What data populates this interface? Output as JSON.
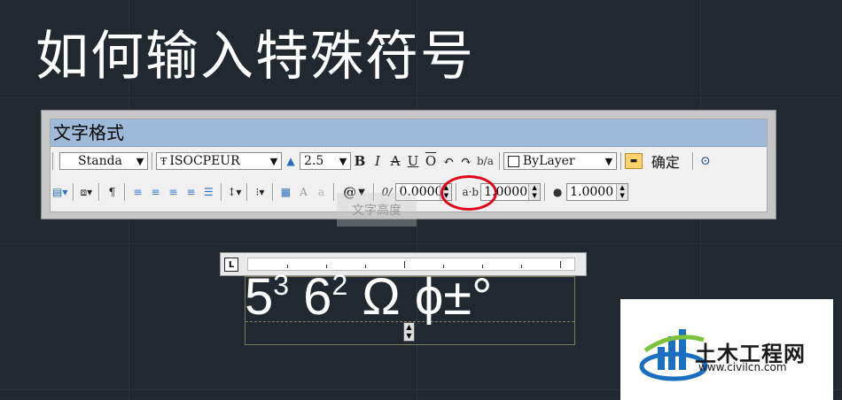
{
  "page_title": "如何输入特殊符号",
  "window": {
    "title": "文字格式"
  },
  "toolbar_row1": {
    "style_combo": "Standa",
    "font_combo": "ISOCPEUR",
    "height_combo": "2.5",
    "bold": "B",
    "italic": "I",
    "strike": "A",
    "underline": "U",
    "overline": "O",
    "undo": "↶",
    "redo": "↷",
    "stack": "b/a",
    "color_combo": "ByLayer",
    "ok_button": "确定"
  },
  "toolbar_row2": {
    "symbol_button": "@",
    "oblique_value": "0.0000",
    "tracking_value": "1.0000",
    "width_value": "1.0000"
  },
  "tooltip_ghost": "文字高度",
  "editor": {
    "segment1": "5",
    "sup1": "3",
    "segment2": " 6",
    "sup2": "2",
    "segment3": " Ω ϕ±°"
  },
  "ruler": {
    "tab_label": "L"
  },
  "watermark": {
    "name": "土木工程网",
    "url": "www.civilcn.com"
  },
  "colors": {
    "background": "#212830",
    "titlebar": "#9dbbd9",
    "highlight": "#e3001b"
  }
}
